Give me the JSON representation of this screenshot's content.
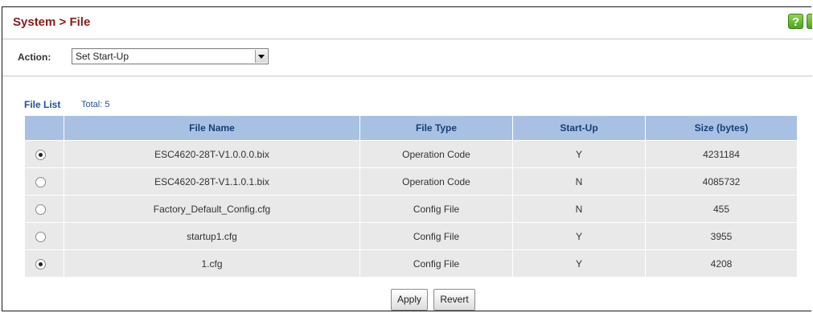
{
  "header": {
    "title": "System > File",
    "help_label": "?"
  },
  "action": {
    "label": "Action:",
    "selected": "Set Start-Up"
  },
  "file_list": {
    "title": "File List",
    "total": "Total: 5",
    "columns": [
      "File Name",
      "File Type",
      "Start-Up",
      "Size (bytes)"
    ],
    "rows": [
      {
        "selected": true,
        "name": "ESC4620-28T-V1.0.0.0.bix",
        "type": "Operation Code",
        "startup": "Y",
        "size": "4231184"
      },
      {
        "selected": false,
        "name": "ESC4620-28T-V1.1.0.1.bix",
        "type": "Operation Code",
        "startup": "N",
        "size": "4085732"
      },
      {
        "selected": false,
        "name": "Factory_Default_Config.cfg",
        "type": "Config File",
        "startup": "N",
        "size": "455"
      },
      {
        "selected": false,
        "name": "startup1.cfg",
        "type": "Config File",
        "startup": "Y",
        "size": "3955"
      },
      {
        "selected": true,
        "name": "1.cfg",
        "type": "Config File",
        "startup": "Y",
        "size": "4208"
      }
    ]
  },
  "buttons": {
    "apply": "Apply",
    "revert": "Revert"
  }
}
